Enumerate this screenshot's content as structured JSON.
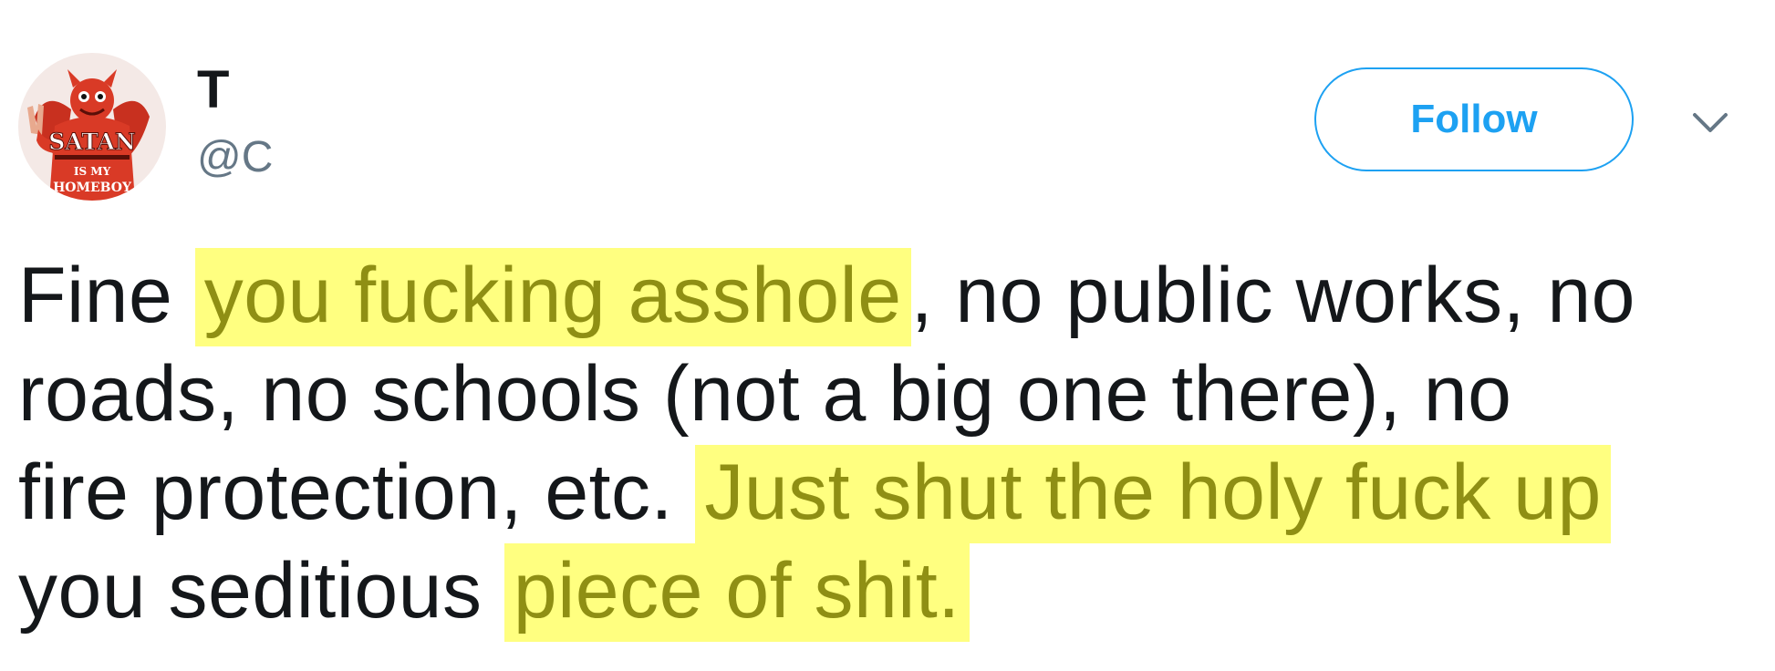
{
  "author": {
    "display_name": "T",
    "handle": "@C",
    "avatar": {
      "icon": "satan-avatar-icon",
      "text_top": "SATAN",
      "text_mid": "IS MY",
      "text_bottom": "HOMEBOY",
      "colors": {
        "primary": "#d93a26",
        "dark": "#8e1c12"
      }
    }
  },
  "actions": {
    "follow_label": "Follow",
    "menu_icon": "chevron-down-icon"
  },
  "tweet": {
    "lines": [
      [
        {
          "text": "Fine ",
          "highlight": false
        },
        {
          "text": "you fucking asshole",
          "highlight": true
        },
        {
          "text": ", no public works, no",
          "highlight": false
        }
      ],
      [
        {
          "text": "roads, no schools (not a big one there), no",
          "highlight": false
        }
      ],
      [
        {
          "text": "fire protection, etc. ",
          "highlight": false
        },
        {
          "text": "Just shut the holy fuck up",
          "highlight": true
        }
      ],
      [
        {
          "text": "you seditious ",
          "highlight": false
        },
        {
          "text": "piece of shit.",
          "highlight": true
        }
      ]
    ]
  },
  "colors": {
    "accent": "#1da1f2",
    "text": "#14171a",
    "secondary_text": "#657786",
    "highlight_bg": "#ffff80",
    "highlight_text": "#8f8f14"
  }
}
